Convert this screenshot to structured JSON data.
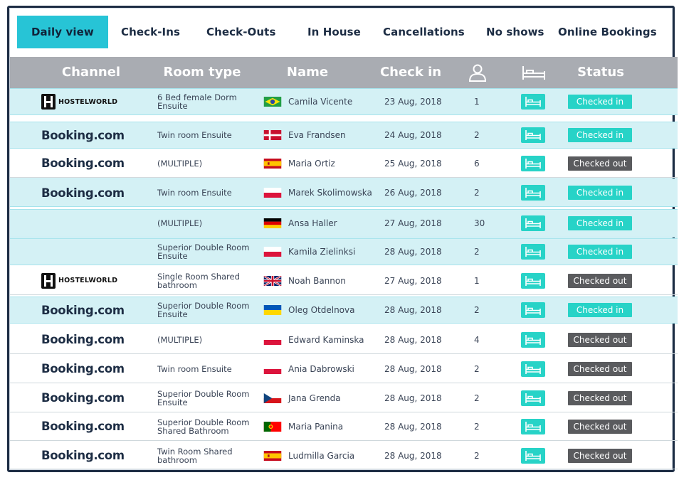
{
  "tabs": [
    {
      "label": "Daily view",
      "active": true
    },
    {
      "label": "Check-Ins"
    },
    {
      "label": "Check-Outs"
    },
    {
      "label": "In House"
    },
    {
      "label": "Cancellations"
    },
    {
      "label": "No shows"
    },
    {
      "label": "Online Bookings"
    }
  ],
  "headers": {
    "channel": "Channel",
    "room_type": "Room type",
    "name": "Name",
    "check_in": "Check in",
    "guests_icon": "person-icon",
    "bed_icon": "bed-icon",
    "status": "Status"
  },
  "colors": {
    "accent": "#27c4d6",
    "checked_in": "#27d3c7",
    "checked_out": "#5a5b5e",
    "header_bg": "#a9acb2",
    "highlight_row": "#d4f1f5"
  },
  "rows": [
    {
      "channel": "HOSTELWORLD",
      "channel_type": "hostelworld",
      "room_type": "6 Bed female Dorm Ensuite",
      "flag": "brazil",
      "name": "Camila Vicente",
      "check_in": "23 Aug, 2018",
      "guests": "1",
      "status": "Checked in",
      "highlight": true
    },
    {
      "channel": "Booking.com",
      "channel_type": "booking",
      "room_type": "Twin room Ensuite",
      "flag": "denmark",
      "name": "Eva Frandsen",
      "check_in": "24 Aug, 2018",
      "guests": "2",
      "status": "Checked in",
      "highlight": true
    },
    {
      "channel": "Booking.com",
      "channel_type": "booking",
      "room_type": "(MULTIPLE)",
      "flag": "spain",
      "name": "Maria Ortiz",
      "check_in": "25 Aug, 2018",
      "guests": "6",
      "status": "Checked out",
      "highlight": false
    },
    {
      "channel": "Booking.com",
      "channel_type": "booking",
      "room_type": "Twin room Ensuite",
      "flag": "poland",
      "name": "Marek Skolimowska",
      "check_in": "26 Aug, 2018",
      "guests": "2",
      "status": "Checked in",
      "highlight": true
    },
    {
      "channel": "",
      "channel_type": "none",
      "room_type": "(MULTIPLE)",
      "flag": "germany",
      "name": "Ansa Haller",
      "check_in": "27 Aug, 2018",
      "guests": "30",
      "status": "Checked in",
      "highlight": true
    },
    {
      "channel": "",
      "channel_type": "none",
      "room_type": "Superior Double Room Ensuite",
      "flag": "poland",
      "name": "Kamila Zielinksi",
      "check_in": "28 Aug, 2018",
      "guests": "2",
      "status": "Checked in",
      "highlight": true
    },
    {
      "channel": "HOSTELWORLD",
      "channel_type": "hostelworld",
      "room_type": "Single Room Shared bathroom",
      "flag": "uk",
      "name": "Noah Bannon",
      "check_in": "27 Aug, 2018",
      "guests": "1",
      "status": "Checked out",
      "highlight": false
    },
    {
      "channel": "Booking.com",
      "channel_type": "booking",
      "room_type": "Superior Double Room Ensuite",
      "flag": "ukraine",
      "name": "Oleg Otdelnova",
      "check_in": "28 Aug, 2018",
      "guests": "2",
      "status": "Checked in",
      "highlight": true
    },
    {
      "channel": "Booking.com",
      "channel_type": "booking",
      "room_type": "(MULTIPLE)",
      "flag": "poland",
      "name": "Edward Kaminska",
      "check_in": "28 Aug, 2018",
      "guests": "4",
      "status": "Checked out",
      "highlight": false
    },
    {
      "channel": "Booking.com",
      "channel_type": "booking",
      "room_type": "Twin room Ensuite",
      "flag": "poland",
      "name": "Ania Dabrowski",
      "check_in": "28 Aug, 2018",
      "guests": "2",
      "status": "Checked out",
      "highlight": false
    },
    {
      "channel": "Booking.com",
      "channel_type": "booking",
      "room_type": "Superior Double Room Ensuite",
      "flag": "czech",
      "name": "Jana Grenda",
      "check_in": "28 Aug, 2018",
      "guests": "2",
      "status": "Checked out",
      "highlight": false
    },
    {
      "channel": "Booking.com",
      "channel_type": "booking",
      "room_type": "Superior Double Room Shared Bathroom",
      "flag": "portugal",
      "name": "Maria Panina",
      "check_in": "28 Aug, 2018",
      "guests": "2",
      "status": "Checked out",
      "highlight": false
    },
    {
      "channel": "Booking.com",
      "channel_type": "booking",
      "room_type": "Twin Room Shared bathroom",
      "flag": "spain",
      "name": "Ludmilla  Garcia",
      "check_in": "28 Aug, 2018",
      "guests": "2",
      "status": "Checked out",
      "highlight": false
    }
  ]
}
